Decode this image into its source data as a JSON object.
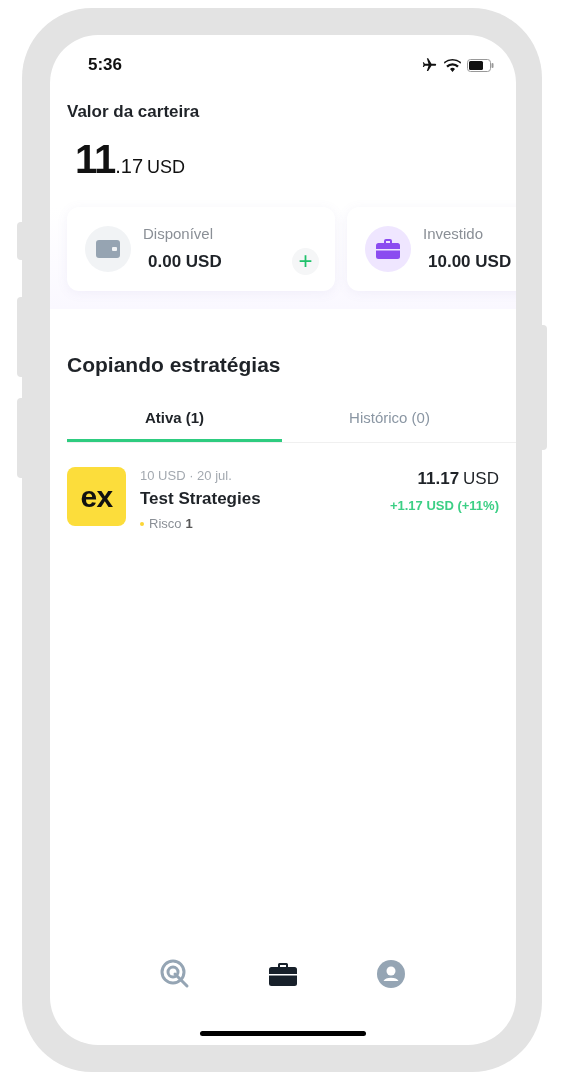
{
  "status_bar": {
    "time": "5:36"
  },
  "wallet": {
    "label": "Valor da carteira",
    "integer": "11",
    "decimals": ".17",
    "currency": "USD"
  },
  "balances": [
    {
      "kind": "available",
      "label": "Disponível",
      "value": "0.00 USD",
      "add_button": "+"
    },
    {
      "kind": "invested",
      "label": "Investido",
      "value": "10.00 USD"
    }
  ],
  "section_title": "Copiando estratégias",
  "tabs": [
    {
      "label": "Ativa (1)",
      "selected": true
    },
    {
      "label": "Histórico (0)",
      "selected": false
    }
  ],
  "strategies": [
    {
      "logo": "ex",
      "meta": "10 USD · 20 jul.",
      "name": "Test Strategies",
      "risk_label": "Risco",
      "risk_value": "1",
      "color": "#fcd535",
      "value": "11.17",
      "currency": "USD",
      "change": "+1.17 USD (+11%)"
    }
  ],
  "bottom_nav": [
    {
      "kind": "discover",
      "selected": false
    },
    {
      "kind": "portfolio",
      "selected": true
    },
    {
      "kind": "profile",
      "selected": false
    }
  ]
}
